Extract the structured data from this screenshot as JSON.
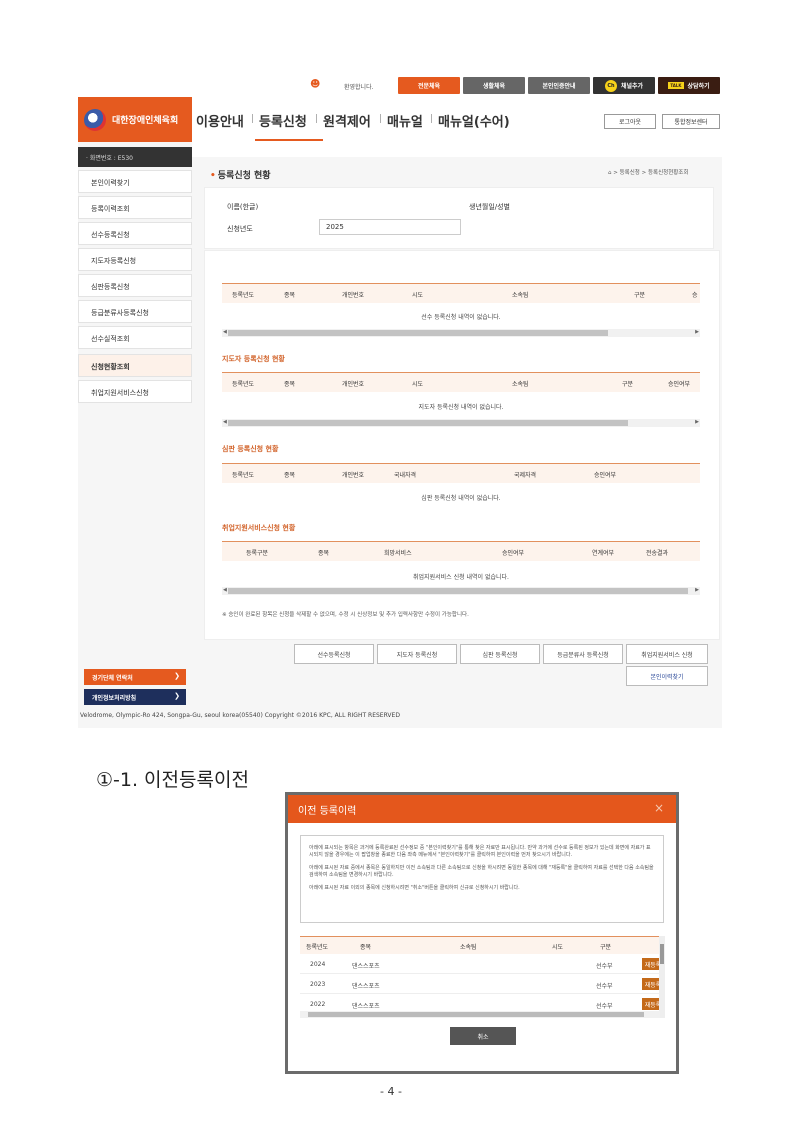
{
  "shot1": {
    "topbar": {
      "welcome": "환영합니다.",
      "btn_expert": "전문체육",
      "btn_life": "생활체육",
      "btn_auth": "본인인증안내",
      "btn_channel": "채널추가",
      "btn_channel_badge": "Ch",
      "btn_consult": "상담하기",
      "btn_consult_badge": "TALK",
      "colors": {
        "expert": "#e55a1f",
        "life": "#666666",
        "auth": "#666666",
        "channel": "#333333",
        "consult": "#3a1d12"
      }
    },
    "logo": {
      "org": "대한장애인체육회",
      "brand_color": "#e55a1f"
    },
    "nav": {
      "items": [
        "이용안내",
        "등록신청",
        "원격제어",
        "매뉴얼",
        "매뉴얼(수어)"
      ],
      "logout": "로그아웃",
      "portal": "통합정보센터"
    },
    "sidebar": {
      "screen_no": "· 화면번호 : E530",
      "items": [
        "본인이력찾기",
        "등록이력조회",
        "선수등록신청",
        "지도자등록신청",
        "심판등록신청",
        "등급분류사등록신청",
        "선수실적조회",
        "신청현황조회",
        "취업지원서비스신청"
      ],
      "bottom1": "경기단체 연락처",
      "bottom2": "개인정보처리방침"
    },
    "page": {
      "title": "등록신청 현황",
      "breadcrumb": "> 등록신청 > 등록신청현황조회",
      "label_name": "이름(한글)",
      "label_birth": "생년월일/성별",
      "label_year": "신청년도",
      "year_value": "2025"
    },
    "athlete": {
      "headers": [
        "등록년도",
        "종목",
        "개인번호",
        "시도",
        "소속팀",
        "구분",
        "승"
      ],
      "empty": "선수 등록신청 내역이 없습니다."
    },
    "coach": {
      "title": "지도자 등록신청 현황",
      "headers": [
        "등록년도",
        "종목",
        "개인번호",
        "시도",
        "소속팀",
        "구분",
        "승인여부"
      ],
      "empty": "지도자 등록신청 내역이 없습니다."
    },
    "referee": {
      "title": "심판 등록신청 현황",
      "headers": [
        "등록년도",
        "종목",
        "개인번호",
        "국내자격",
        "국제자격",
        "승인여부"
      ],
      "empty": "심판 등록신청 내역이 없습니다."
    },
    "job": {
      "title": "취업지원서비스신청 현황",
      "headers": [
        "등록구분",
        "종목",
        "희망서비스",
        "승인여부",
        "연계여부",
        "전송결과"
      ],
      "empty": "취업지원서비스 신청 내역이 없습니다."
    },
    "notice": "※ 승인이 완료된 항목은 신청을 삭제할 수 없으며, 수정 시 신상정보 및 추가 입력사항만 수정이 가능합니다.",
    "actions": [
      "선수등록신청",
      "지도자 등록신청",
      "심판 등록신청",
      "등급분류사 등록신청",
      "취업지원서비스 신청",
      "본인이력찾기"
    ],
    "footer": "Velodrome, Olympic-Ro 424, Songpa-Gu, seoul korea(05540) Copyright ©2016 KPC, ALL RIGHT RESERVED"
  },
  "heading": "①-1. 이전등록이전",
  "modal": {
    "title": "이전 등록이력",
    "close": "×",
    "info": [
      "아래에 표시되는 항목은 과거에 등록완료된 선수정보 중 \"본인이력찾기\"를 통해 찾은 자료만 표시됩니다. 만약 과거에 선수로 등록된 정보가 있는데 화면에 자료가 표시되지 않을 경우에는 이 팝업창을 종료한 다음 좌측 메뉴에서 \"본인이력찾기\"를 클릭하여 본인이력을 먼저 찾으시기 바랍니다.",
      "아래에 표시된 자료 중에서 종목은 동일하지만 이전 소속팀과 다른 소속팀으로 신청을 하시려면 동일한 종목에 대해 \"재등록\"을 클릭하여 자료를 선택한 다음 소속팀을 검색하여 소속팀을 변경하시기 바랍니다.",
      "아래에 표시된 자료 이외의 종목에 신청하시려면 \"취소\"버튼을 클릭하여 신규로 신청하시기 바랍니다."
    ],
    "headers": [
      "등록년도",
      "종목",
      "소속팀",
      "시도",
      "구분"
    ],
    "rows": [
      {
        "year": "2024",
        "sport": "댄스스포츠",
        "team": "",
        "region": "",
        "type": "선수부",
        "action": "재등록"
      },
      {
        "year": "2023",
        "sport": "댄스스포츠",
        "team": "",
        "region": "",
        "type": "선수부",
        "action": "재등록"
      },
      {
        "year": "2022",
        "sport": "댄스스포츠",
        "team": "",
        "region": "",
        "type": "선수부",
        "action": "재등록"
      }
    ],
    "cancel": "취소"
  },
  "page_number": "- 4 -"
}
